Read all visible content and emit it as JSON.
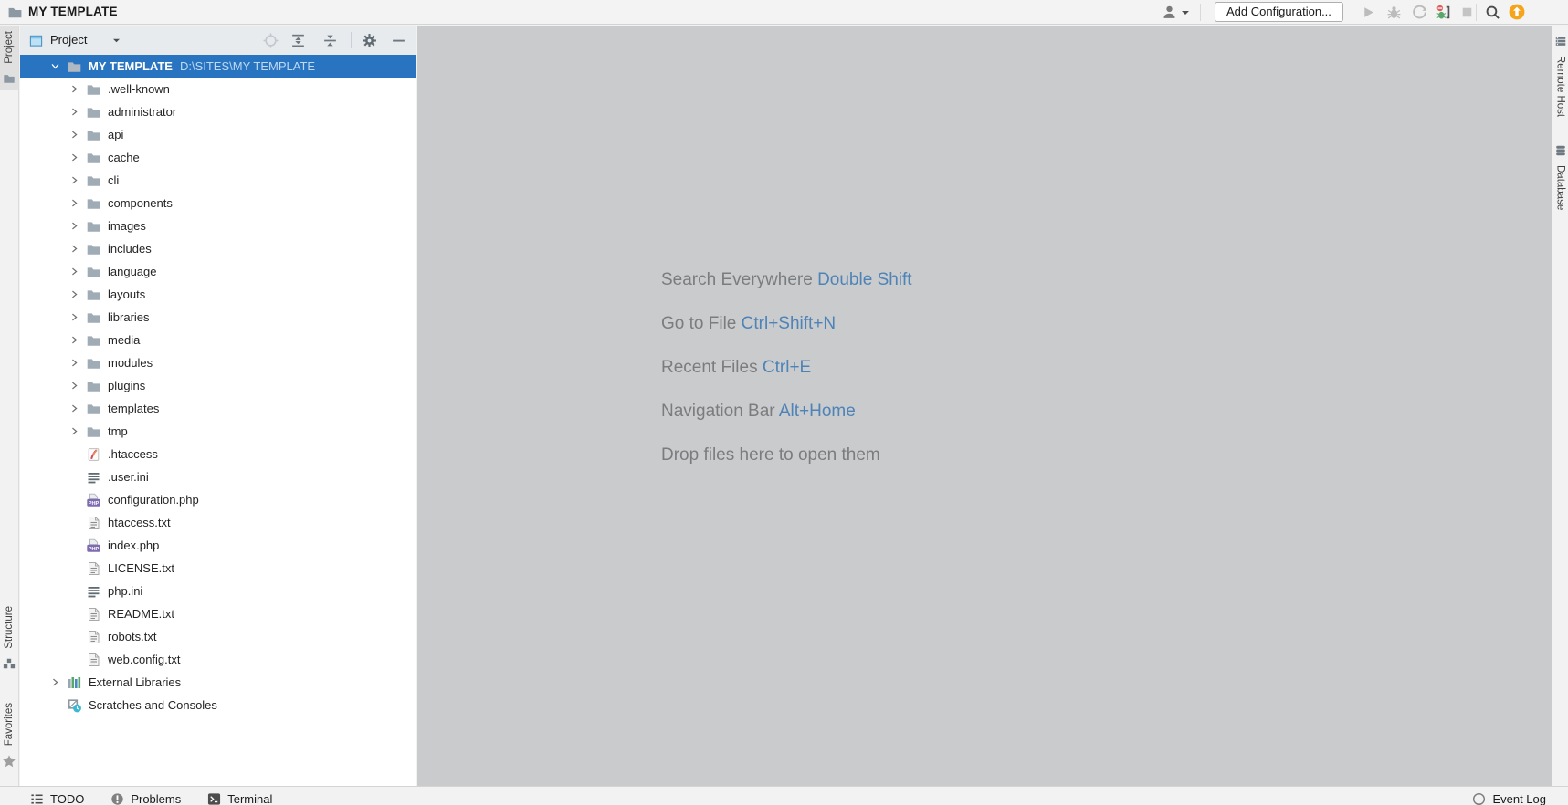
{
  "titlebar": {
    "title": "MY TEMPLATE",
    "add_configuration_label": "Add Configuration..."
  },
  "panel": {
    "selector_label": "Project"
  },
  "tree": {
    "items": [
      {
        "label": "MY TEMPLATE",
        "path": "D:\\SITES\\MY TEMPLATE",
        "icon": "folder",
        "depth": 0,
        "chevron": "open",
        "selected": true
      },
      {
        "label": ".well-known",
        "icon": "folder",
        "depth": 1,
        "chevron": "closed"
      },
      {
        "label": "administrator",
        "icon": "folder",
        "depth": 1,
        "chevron": "closed"
      },
      {
        "label": "api",
        "icon": "folder",
        "depth": 1,
        "chevron": "closed"
      },
      {
        "label": "cache",
        "icon": "folder",
        "depth": 1,
        "chevron": "closed"
      },
      {
        "label": "cli",
        "icon": "folder",
        "depth": 1,
        "chevron": "closed"
      },
      {
        "label": "components",
        "icon": "folder",
        "depth": 1,
        "chevron": "closed"
      },
      {
        "label": "images",
        "icon": "folder",
        "depth": 1,
        "chevron": "closed"
      },
      {
        "label": "includes",
        "icon": "folder",
        "depth": 1,
        "chevron": "closed"
      },
      {
        "label": "language",
        "icon": "folder",
        "depth": 1,
        "chevron": "closed"
      },
      {
        "label": "layouts",
        "icon": "folder",
        "depth": 1,
        "chevron": "closed"
      },
      {
        "label": "libraries",
        "icon": "folder",
        "depth": 1,
        "chevron": "closed"
      },
      {
        "label": "media",
        "icon": "folder",
        "depth": 1,
        "chevron": "closed"
      },
      {
        "label": "modules",
        "icon": "folder",
        "depth": 1,
        "chevron": "closed"
      },
      {
        "label": "plugins",
        "icon": "folder",
        "depth": 1,
        "chevron": "closed"
      },
      {
        "label": "templates",
        "icon": "folder",
        "depth": 1,
        "chevron": "closed"
      },
      {
        "label": "tmp",
        "icon": "folder",
        "depth": 1,
        "chevron": "closed"
      },
      {
        "label": ".htaccess",
        "icon": "apache",
        "depth": 1
      },
      {
        "label": ".user.ini",
        "icon": "ini",
        "depth": 1
      },
      {
        "label": "configuration.php",
        "icon": "php",
        "depth": 1
      },
      {
        "label": "htaccess.txt",
        "icon": "text",
        "depth": 1
      },
      {
        "label": "index.php",
        "icon": "php",
        "depth": 1
      },
      {
        "label": "LICENSE.txt",
        "icon": "text",
        "depth": 1
      },
      {
        "label": "php.ini",
        "icon": "ini",
        "depth": 1
      },
      {
        "label": "README.txt",
        "icon": "text",
        "depth": 1
      },
      {
        "label": "robots.txt",
        "icon": "text",
        "depth": 1
      },
      {
        "label": "web.config.txt",
        "icon": "text",
        "depth": 1
      },
      {
        "label": "External Libraries",
        "icon": "external-libs",
        "depth": 0,
        "chevron": "closed"
      },
      {
        "label": "Scratches and Consoles",
        "icon": "scratches",
        "depth": 0
      }
    ]
  },
  "editor": {
    "hints": [
      {
        "label": "Search Everywhere",
        "shortcut": "Double Shift"
      },
      {
        "label": "Go to File",
        "shortcut": "Ctrl+Shift+N"
      },
      {
        "label": "Recent Files",
        "shortcut": "Ctrl+E"
      },
      {
        "label": "Navigation Bar",
        "shortcut": "Alt+Home"
      },
      {
        "label": "Drop files here to open them",
        "shortcut": ""
      }
    ]
  },
  "stripes": {
    "left": {
      "project": "Project",
      "structure": "Structure",
      "favorites": "Favorites"
    },
    "right": {
      "remote_host": "Remote Host",
      "database": "Database"
    }
  },
  "statusbar": {
    "left_items": [
      {
        "label": "TODO",
        "icon": "todo"
      },
      {
        "label": "Problems",
        "icon": "problems"
      },
      {
        "label": "Terminal",
        "icon": "terminal"
      }
    ],
    "event_log_label": "Event Log"
  },
  "colors": {
    "selection_blue": "#2874C1",
    "shortcut_blue": "#4E83B8",
    "update_badge_orange": "#F7A41D",
    "php_badge_purple": "#7E6BB0",
    "folder_gray": "#9FACB6",
    "editor_background": "#CACBCC"
  }
}
